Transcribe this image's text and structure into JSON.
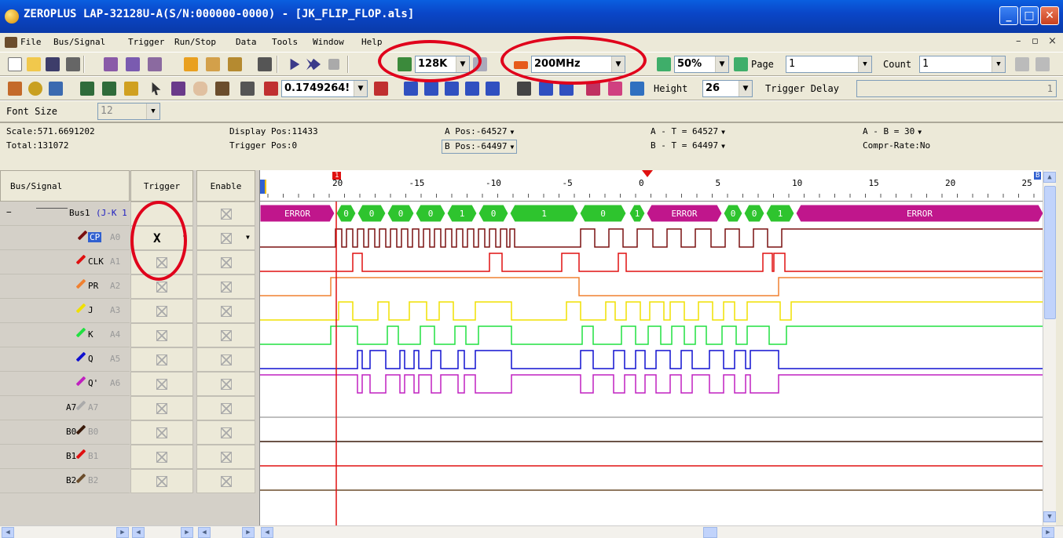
{
  "window": {
    "title": "ZEROPLUS LAP-32128U-A(S/N:000000-0000) - [JK_FLIP_FLOP.als]"
  },
  "menu": [
    "File",
    "Bus/Signal",
    "Trigger",
    "Run/Stop",
    "Data",
    "Tools",
    "Window",
    "Help"
  ],
  "mdi_controls": [
    "–",
    "▫",
    "×"
  ],
  "toolbar1": {
    "memory": "128K",
    "frequency": "200MHz",
    "zoom": "50%",
    "page_label": "Page",
    "page_value": "1",
    "count_label": "Count",
    "count_value": "1"
  },
  "toolbar2": {
    "cursor_value": "0.1749264!",
    "height_label": "Height",
    "height_value": "26",
    "trigger_delay_label": "Trigger Delay",
    "trigger_delay_value": "1"
  },
  "toolbar3": {
    "font_size_label": "Font Size",
    "font_size_value": "12"
  },
  "info": {
    "scale": "Scale:571.6691202",
    "total": "Total:131072",
    "display_pos": "Display Pos:11433",
    "trigger_pos": "Trigger Pos:0",
    "a_pos": "A Pos:-64527",
    "b_pos": "B Pos:-64497",
    "a_t": "A - T = 64527",
    "b_t": "B - T = 64497",
    "a_b": "A - B = 30",
    "compr_rate": "Compr-Rate:No"
  },
  "table": {
    "headers": [
      "Bus/Signal",
      "Trigger",
      "Enable"
    ],
    "bus": {
      "name": "Bus1",
      "detail": "(J-K 1"
    },
    "signals": [
      {
        "name": "CP",
        "ch": "A0",
        "color": "#7a1010"
      },
      {
        "name": "CLK",
        "ch": "A1",
        "color": "#e01010"
      },
      {
        "name": "PR",
        "ch": "A2",
        "color": "#f08030"
      },
      {
        "name": "J",
        "ch": "A3",
        "color": "#f0e000"
      },
      {
        "name": "K",
        "ch": "A4",
        "color": "#20e040"
      },
      {
        "name": "Q",
        "ch": "A5",
        "color": "#1010d0"
      },
      {
        "name": "Q'",
        "ch": "A6",
        "color": "#c020c0"
      },
      {
        "name": "A7",
        "ch": "A7",
        "color": "#aaaaaa"
      },
      {
        "name": "B0",
        "ch": "B0",
        "color": "#3a1a0a"
      },
      {
        "name": "B1",
        "ch": "B1",
        "color": "#e01010"
      },
      {
        "name": "B2",
        "ch": "B2",
        "color": "#6b4d2c"
      }
    ],
    "cp_trigger": "X"
  },
  "ruler": {
    "ticks": [
      "20",
      "-15",
      "-10",
      "-5",
      "0",
      "5",
      "10",
      "15",
      "20",
      "25"
    ],
    "cursor_a": "1",
    "cursor_b": "B"
  },
  "bus_segments": [
    "ERROR",
    "0",
    "0",
    "0",
    "0",
    "1",
    "0",
    "1",
    "0",
    "1",
    "ERROR",
    "0",
    "0",
    "1",
    "ERROR"
  ],
  "colors": {
    "bus_error": "#c0168c",
    "bus_data": "#2ec42e",
    "title_bar": "#0a46c8",
    "annotation": "#e0001b"
  }
}
